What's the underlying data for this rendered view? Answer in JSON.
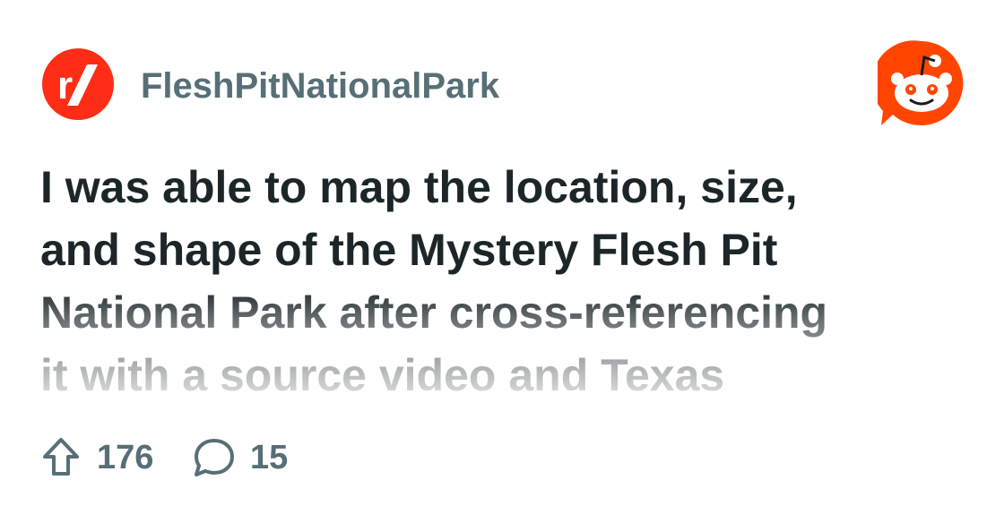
{
  "subreddit": {
    "name": "FleshPitNationalPark",
    "icon": "reddit-r-slash-icon",
    "brand_color": "#ff2d16"
  },
  "app_logo": {
    "icon": "reddit-snoo-icon",
    "color": "#ff4500"
  },
  "post": {
    "title_lines": [
      "I was able to map the location, size,",
      "and shape of the Mystery Flesh Pit",
      "National Park after cross-referencing",
      "it with a source video and Texas"
    ]
  },
  "stats": {
    "upvotes": "176",
    "upvote_icon": "upvote-arrow-icon",
    "comments": "15",
    "comment_icon": "comment-bubble-icon"
  }
}
